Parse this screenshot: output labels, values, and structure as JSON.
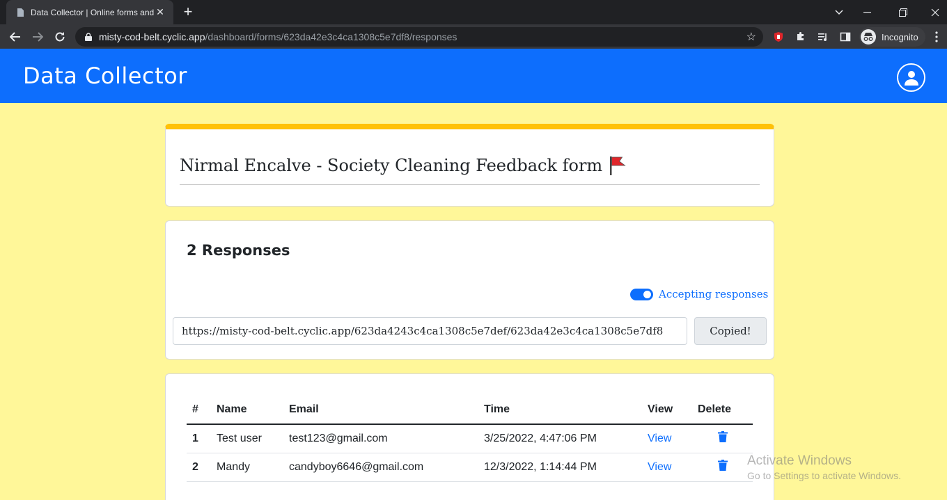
{
  "browser": {
    "tab_title": "Data Collector | Online forms and",
    "new_tab_symbol": "+",
    "url_host": "misty-cod-belt.cyclic.app",
    "url_path": "/dashboard/forms/623da42e3c4ca1308c5e7df8/responses",
    "profile_label": "Incognito"
  },
  "app": {
    "brand": "Data Collector"
  },
  "form": {
    "title": "Nirmal Encalve - Society Cleaning Feedback form"
  },
  "responses": {
    "count_label": "2 Responses",
    "accepting_label": "Accepting responses",
    "accepting": true,
    "share_url": "https://misty-cod-belt.cyclic.app/623da4243c4ca1308c5e7def/623da42e3c4ca1308c5e7df8",
    "copy_button": "Copied!"
  },
  "table": {
    "headers": [
      "#",
      "Name",
      "Email",
      "Time",
      "View",
      "Delete"
    ],
    "rows": [
      {
        "num": "1",
        "name": "Test user",
        "email": "test123@gmail.com",
        "time": "3/25/2022, 4:47:06 PM",
        "view": "View"
      },
      {
        "num": "2",
        "name": "Mandy",
        "email": "candyboy6646@gmail.com",
        "time": "12/3/2022, 1:14:44 PM",
        "view": "View"
      }
    ]
  },
  "watermark": {
    "line1": "Activate Windows",
    "line2": "Go to Settings to activate Windows."
  },
  "colors": {
    "primary": "#0d6efd",
    "background": "#fff799",
    "accent": "#ffc107",
    "flag": "#e0262b"
  }
}
